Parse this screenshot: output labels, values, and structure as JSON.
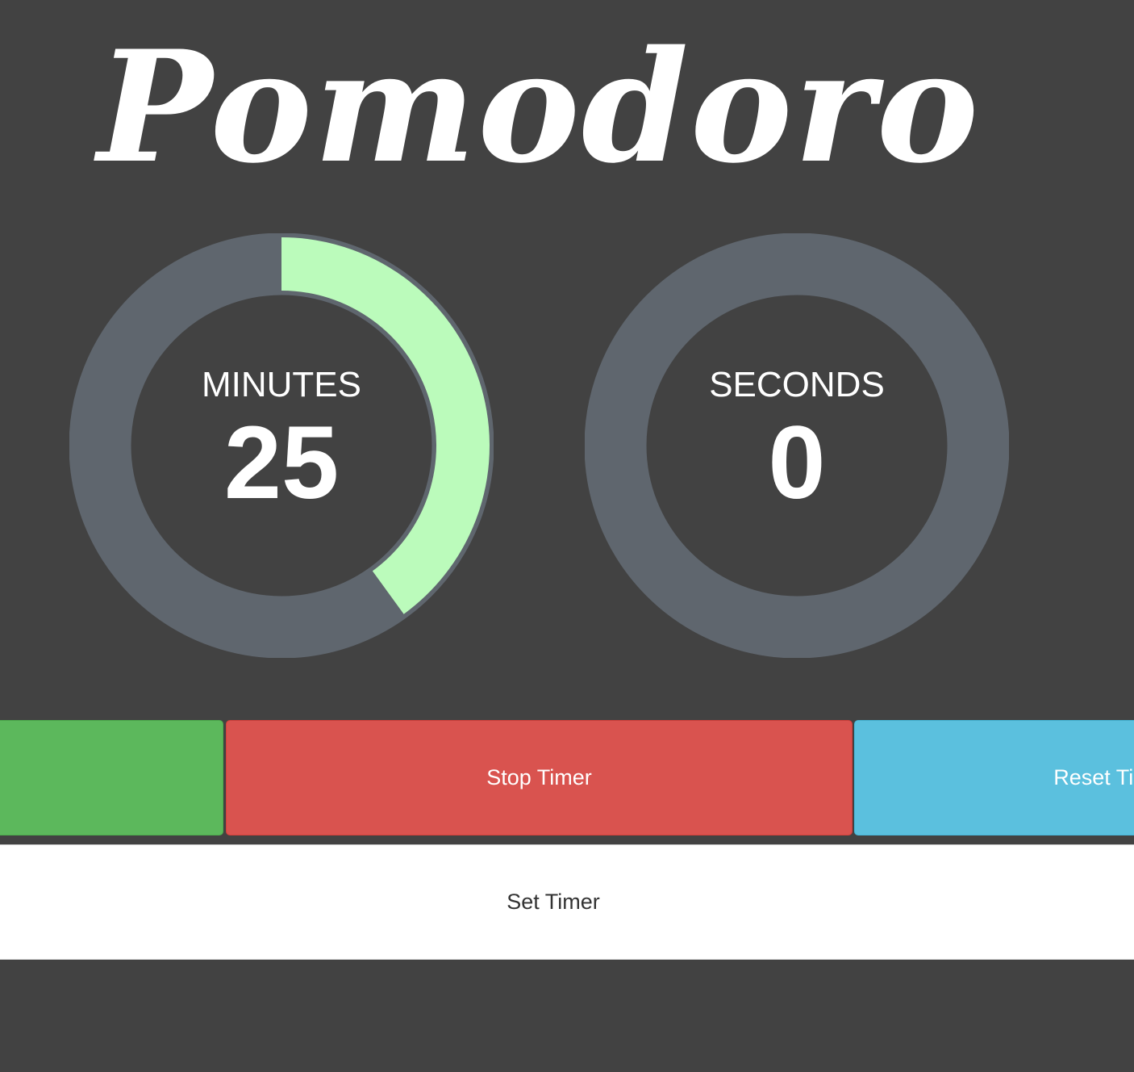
{
  "app": {
    "title": "Pomodoro"
  },
  "timer": {
    "minutes": {
      "label": "MINUTES",
      "value": "25",
      "progress_fraction": 0.4
    },
    "seconds": {
      "label": "SECONDS",
      "value": "0",
      "progress_fraction": 0
    }
  },
  "controls": {
    "start_label": "",
    "stop_label": "Stop Timer",
    "reset_label": "Reset Timer",
    "set_label": "Set Timer"
  },
  "colors": {
    "background": "#424242",
    "ring_track": "#5f666e",
    "ring_progress": "#bbfbbb",
    "start": "#5cb85c",
    "stop": "#d9534f",
    "reset": "#5bc0de",
    "set": "#ffffff"
  }
}
